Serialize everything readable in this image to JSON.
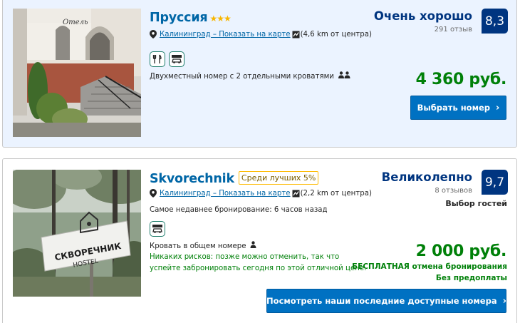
{
  "hotels": [
    {
      "name": "Пруссия",
      "stars": "★★★",
      "location_link": "Калининград – Показать на карте",
      "distance": "(4,6 km от центра)",
      "room_type": "Двухместный номер с 2 отдельными кроватями",
      "score_label": "Очень хорошо",
      "review_count": "291 отзыв",
      "score": "8,3",
      "price": "4 360 руб.",
      "button_label": "Выбрать номер"
    },
    {
      "name": "Skvorechnik",
      "top_badge": "Среди лучших 5%",
      "location_link": "Калининград – Показать на карте",
      "distance": "(2,2 km от центра)",
      "recent_booking": "Самое недавнее бронирование: 6 часов назад",
      "room_type": "Кровать в общем номере",
      "no_risk_line1": "Никаких рисков: позже можно отменить, так что",
      "no_risk_line2": "успейте забронировать сегодня по этой отличной цене.",
      "score_label": "Великолепно",
      "review_count": "8 отзывов",
      "score": "9,7",
      "guest_choice": "Выбор гостей",
      "price": "2 000 руб.",
      "free_cancel": "БЕСПЛАТНАЯ отмена бронирования",
      "no_prepay": "Без предоплаты",
      "button_label": "Посмотреть наши последние доступные номера",
      "sign_title": "СКВОРЕЧНИК",
      "sign_subtitle": "HOSTEL"
    }
  ],
  "colors": {
    "brand_blue": "#003580",
    "link_blue": "#0066a6",
    "button_blue": "#0071c2",
    "price_green": "#008009",
    "star_yellow": "#f8b600",
    "card1_bg": "#ebf3ff"
  },
  "icons": {
    "location": "map-pin-icon",
    "map": "map-icon",
    "restaurant": "restaurant-icon",
    "parking": "parking-icon",
    "beds": "people-icon",
    "single_bed": "person-icon",
    "chevron": "chevron-right-icon"
  }
}
